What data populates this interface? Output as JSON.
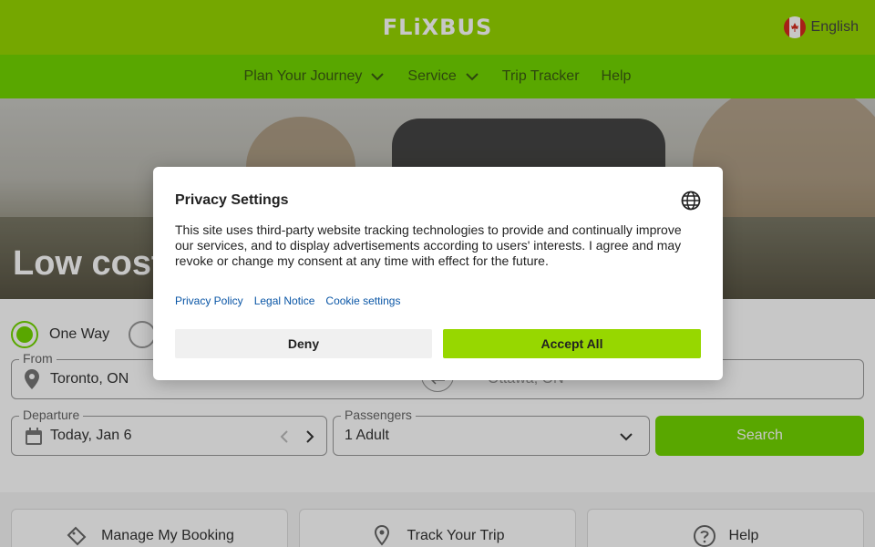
{
  "header": {
    "logo": "FLiXBUS",
    "language": "English"
  },
  "nav": {
    "items": [
      {
        "label": "Plan Your Journey",
        "has_dropdown": true
      },
      {
        "label": "Service",
        "has_dropdown": true
      },
      {
        "label": "Trip Tracker",
        "has_dropdown": false
      },
      {
        "label": "Help",
        "has_dropdown": false
      }
    ]
  },
  "hero": {
    "title": "Low cost"
  },
  "search": {
    "trip_type": {
      "one_way_label": "One Way",
      "selected": "One Way"
    },
    "from": {
      "legend": "From",
      "value": "Toronto, ON"
    },
    "to": {
      "value": "Ottawa, ON"
    },
    "departure": {
      "legend": "Departure",
      "value": "Today, Jan 6"
    },
    "passengers": {
      "legend": "Passengers",
      "value": "1 Adult"
    },
    "search_label": "Search"
  },
  "cards": [
    {
      "label": "Manage My Booking",
      "icon": "ticket-icon"
    },
    {
      "label": "Track Your Trip",
      "icon": "location-tracker-icon"
    },
    {
      "label": "Help",
      "icon": "question-icon"
    }
  ],
  "modal": {
    "title": "Privacy Settings",
    "text": "This site uses third-party website tracking technologies to provide and continually improve our services, and to display advertisements according to users' interests. I agree and may revoke or change my consent at any time with effect for the future.",
    "links": [
      "Privacy Policy",
      "Legal Notice",
      "Cookie settings"
    ],
    "deny_label": "Deny",
    "accept_label": "Accept All"
  },
  "colors": {
    "brand_green": "#73d700",
    "header_green": "#97d700",
    "link_blue": "#0a56a6"
  }
}
